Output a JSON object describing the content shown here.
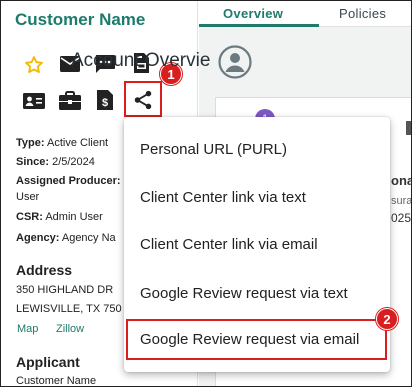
{
  "customer": {
    "name": "Customer Name"
  },
  "actions": [
    "favorite-star",
    "email",
    "text-message",
    "print",
    "id-card",
    "briefcase",
    "document-dollar",
    "share"
  ],
  "details": {
    "type_label": "Type:",
    "type_value": "Active Client",
    "since_label": "Since:",
    "since_value": "2/5/2024",
    "producer_label": "Assigned Producer:",
    "producer_value": "User",
    "csr_label": "CSR:",
    "csr_value": "Admin User",
    "agency_label": "Agency:",
    "agency_value": "Agency Na"
  },
  "address": {
    "title": "Address",
    "line1": "350 HIGHLAND DR",
    "line2": "LEWISVILLE, TX 750",
    "map_link": "Map",
    "zillow_link": "Zillow"
  },
  "applicant": {
    "title": "Applicant",
    "name": "Customer Name"
  },
  "tabs": [
    {
      "label": "Overview",
      "active": true
    },
    {
      "label": "Policies",
      "active": false
    }
  ],
  "account": {
    "title": "Account Overvie"
  },
  "card_peek": {
    "badge": "1",
    "text1": "ona",
    "text2": "sura",
    "text3": "025"
  },
  "menu": {
    "items": [
      "Personal URL (PURL)",
      "Client Center link via text",
      "Client Center link via email",
      "Google Review request via text",
      "Google Review request via email"
    ]
  },
  "callouts": {
    "step1": "1",
    "step2": "2"
  },
  "colors": {
    "brand": "#1e7b6c",
    "callout": "#d81e1e",
    "star": "#f5b800",
    "purple": "#7e57c2"
  }
}
